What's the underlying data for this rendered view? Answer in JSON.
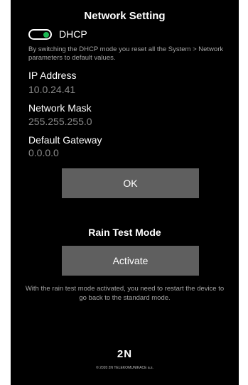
{
  "header": {
    "title": "Network Setting"
  },
  "dhcp": {
    "label": "DHCP",
    "enabled": true,
    "description": "By switching the DHCP mode you reset all the System > Network parameters to default values."
  },
  "fields": {
    "ip_address": {
      "label": "IP Address",
      "value": "10.0.24.41"
    },
    "network_mask": {
      "label": "Network Mask",
      "value": "255.255.255.0"
    },
    "default_gateway": {
      "label": "Default Gateway",
      "value": "0.0.0.0"
    }
  },
  "ok_button": {
    "label": "OK"
  },
  "rain_test": {
    "title": "Rain Test Mode",
    "button_label": "Activate",
    "description": "With the rain test mode activated, you need to restart the device to go back to the standard mode."
  },
  "footer": {
    "logo": "2N",
    "copyright": "© 2020 2N TELEKOMUNIKACE a.s."
  },
  "colors": {
    "background": "#000000",
    "toggle_on": "#1db954",
    "button_bg": "#5f5f5f",
    "muted_text": "#8a8a8a"
  },
  "icons": {
    "dhcp_toggle": "toggle-switch-icon"
  }
}
